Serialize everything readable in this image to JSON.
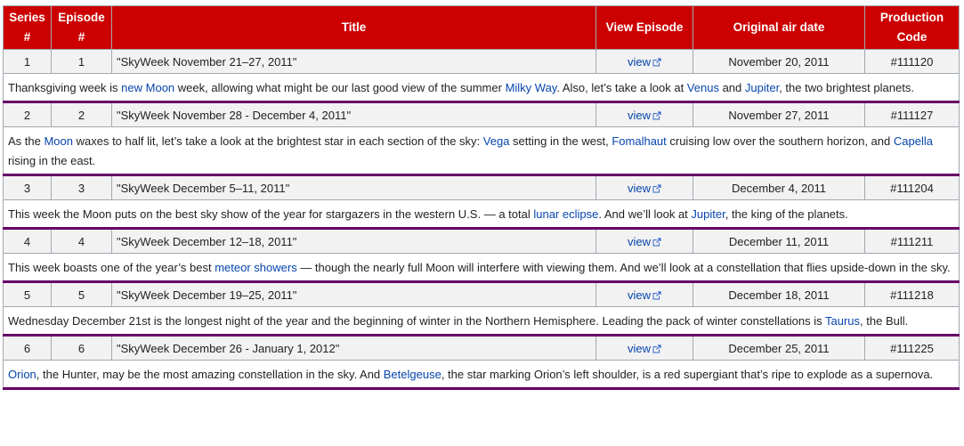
{
  "headers": {
    "series_line1": "Series",
    "series_line2": "#",
    "episode_line1": "Episode",
    "episode_line2": "#",
    "title": "Title",
    "view": "View Episode",
    "airdate": "Original air date",
    "code_line1": "Production",
    "code_line2": "Code"
  },
  "colors": {
    "header_bg": "#cc0000",
    "row_bg": "#f2f2f2",
    "link": "#0645ad",
    "separator": "#660066"
  },
  "episodes": [
    {
      "series": "1",
      "episode": "1",
      "title": "\"SkyWeek November 21–27, 2011\"",
      "view_label": "view",
      "airdate": "November 20, 2011",
      "code": "#111120",
      "summary": [
        {
          "t": "Thanksgiving week is "
        },
        {
          "t": "new Moon",
          "link": true
        },
        {
          "t": " week, allowing what might be our last good view of the summer "
        },
        {
          "t": "Milky Way",
          "link": true
        },
        {
          "t": ". Also, let’s take a look at "
        },
        {
          "t": "Venus",
          "link": true
        },
        {
          "t": " and "
        },
        {
          "t": "Jupiter",
          "link": true
        },
        {
          "t": ", the two brightest planets."
        }
      ]
    },
    {
      "series": "2",
      "episode": "2",
      "title": "\"SkyWeek November 28 - December 4, 2011\"",
      "view_label": "view",
      "airdate": "November 27, 2011",
      "code": "#111127",
      "summary": [
        {
          "t": "As the "
        },
        {
          "t": "Moon",
          "link": true
        },
        {
          "t": " waxes to half lit, let’s take a look at the brightest star in each section of the sky: "
        },
        {
          "t": "Vega",
          "link": true
        },
        {
          "t": " setting in the west, "
        },
        {
          "t": "Fomalhaut",
          "link": true
        },
        {
          "t": " cruising low over the southern horizon, and "
        },
        {
          "t": "Capella",
          "link": true
        },
        {
          "t": " rising in the east."
        }
      ]
    },
    {
      "series": "3",
      "episode": "3",
      "title": "\"SkyWeek December 5–11, 2011\"",
      "view_label": "view",
      "airdate": "December 4, 2011",
      "code": "#111204",
      "summary": [
        {
          "t": "This week the Moon puts on the best sky show of the year for stargazers in the western U.S. — a total "
        },
        {
          "t": "lunar eclipse",
          "link": true
        },
        {
          "t": ". And we’ll look at "
        },
        {
          "t": "Jupiter",
          "link": true
        },
        {
          "t": ", the king of the planets."
        }
      ]
    },
    {
      "series": "4",
      "episode": "4",
      "title": "\"SkyWeek December 12–18, 2011\"",
      "view_label": "view",
      "airdate": "December 11, 2011",
      "code": "#111211",
      "summary": [
        {
          "t": "This week boasts one of the year’s best "
        },
        {
          "t": "meteor showers",
          "link": true
        },
        {
          "t": " — though the nearly full Moon will interfere with viewing them. And we’ll look at a constellation that flies upside-down in the sky."
        }
      ]
    },
    {
      "series": "5",
      "episode": "5",
      "title": "\"SkyWeek December 19–25, 2011\"",
      "view_label": "view",
      "airdate": "December 18, 2011",
      "code": "#111218",
      "summary": [
        {
          "t": "Wednesday December 21st is the longest night of the year and the beginning of winter in the Northern Hemisphere. Leading the pack of winter constellations is "
        },
        {
          "t": "Taurus",
          "link": true
        },
        {
          "t": ", the Bull."
        }
      ]
    },
    {
      "series": "6",
      "episode": "6",
      "title": "\"SkyWeek December 26 - January 1, 2012\"",
      "view_label": "view",
      "airdate": "December 25, 2011",
      "code": "#111225",
      "summary": [
        {
          "t": "Orion",
          "link": true
        },
        {
          "t": ", the Hunter, may be the most amazing constellation in the sky. And "
        },
        {
          "t": "Betelgeuse",
          "link": true
        },
        {
          "t": ", the star marking Orion’s left shoulder, is a red supergiant that’s ripe to explode as a supernova."
        }
      ]
    }
  ]
}
